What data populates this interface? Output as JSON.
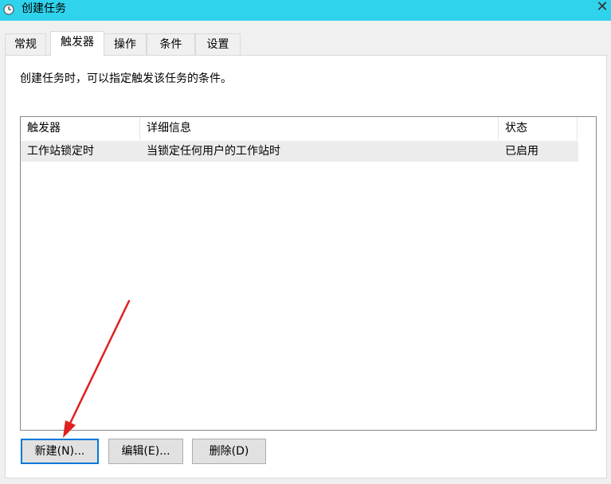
{
  "window": {
    "title": "创建任务",
    "close_glyph": "✕",
    "icon": "clock-icon"
  },
  "tabs": [
    {
      "label": "常规",
      "active": false
    },
    {
      "label": "触发器",
      "active": true
    },
    {
      "label": "操作",
      "active": false
    },
    {
      "label": "条件",
      "active": false
    },
    {
      "label": "设置",
      "active": false
    }
  ],
  "panel": {
    "description": "创建任务时，可以指定触发该任务的条件。"
  },
  "triggers_list": {
    "columns": [
      "触发器",
      "详细信息",
      "状态"
    ],
    "rows": [
      {
        "trigger": "工作站锁定时",
        "details": "当锁定任何用户的工作站时",
        "status": "已启用"
      }
    ]
  },
  "buttons": {
    "new_label": "新建(N)...",
    "edit_label": "编辑(E)...",
    "delete_label": "删除(D)"
  },
  "colors": {
    "titlebar": "#2fd3ec",
    "focus_border": "#0078d7",
    "annotation_arrow": "#e02020"
  }
}
